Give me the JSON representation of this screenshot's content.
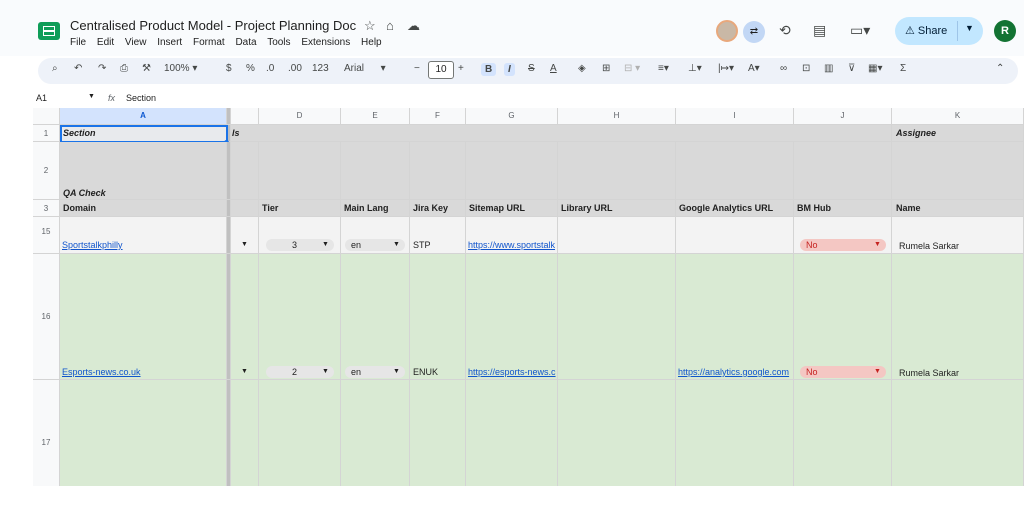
{
  "app": {
    "doc_title": "Centralised Product Model - Project Planning Doc",
    "menu": [
      "File",
      "Edit",
      "View",
      "Insert",
      "Format",
      "Data",
      "Tools",
      "Extensions",
      "Help"
    ],
    "share_label": "Share",
    "user_initial": "R"
  },
  "toolbar": {
    "zoom": "100%",
    "currency": "$",
    "percent": "%",
    "dec_decrease": ".0",
    "dec_increase": ".00",
    "number_format": "123",
    "font": "Arial",
    "font_size": "10",
    "bold": "B",
    "italic": "I",
    "strike": "S",
    "text_color": "A",
    "sum": "Σ"
  },
  "formula_bar": {
    "cell_ref": "A1",
    "fx": "fx",
    "content": "Section"
  },
  "columns": [
    "A",
    "D",
    "E",
    "F",
    "G",
    "H",
    "I",
    "J",
    "K"
  ],
  "rows": {
    "r1": {
      "num": "1",
      "a": "Section",
      "b": "ls",
      "k": "Assignee"
    },
    "r2": {
      "num": "2",
      "a": "QA Check"
    },
    "r3": {
      "num": "3",
      "a": "Domain",
      "d": "Tier",
      "e": "Main Lang",
      "f": "Jira Key",
      "g": "Sitemap URL",
      "h": "Library URL",
      "i": "Google Analytics URL",
      "j": "BM Hub",
      "k": "Name"
    },
    "r15": {
      "num": "15",
      "a": "Sportstalkphilly",
      "d": "3",
      "e": "en",
      "f": "STP",
      "g": "https://www.sportstalk",
      "i": "",
      "j": "No",
      "k": "Rumela Sarkar"
    },
    "r16": {
      "num": "16",
      "a": "Esports-news.co.uk",
      "d": "2",
      "e": "en",
      "f": "ENUK",
      "g": "https://esports-news.c",
      "i": "https://analytics.google.com",
      "j": "No",
      "k": "Rumela Sarkar"
    },
    "r17": {
      "num": "17"
    }
  },
  "colors": {
    "header_gray": "#d9d9d9",
    "row_green": "#d9ead3",
    "link_blue": "#1155cc",
    "badge_red": "#f4c7c3",
    "share_blue": "#c2e7ff"
  }
}
